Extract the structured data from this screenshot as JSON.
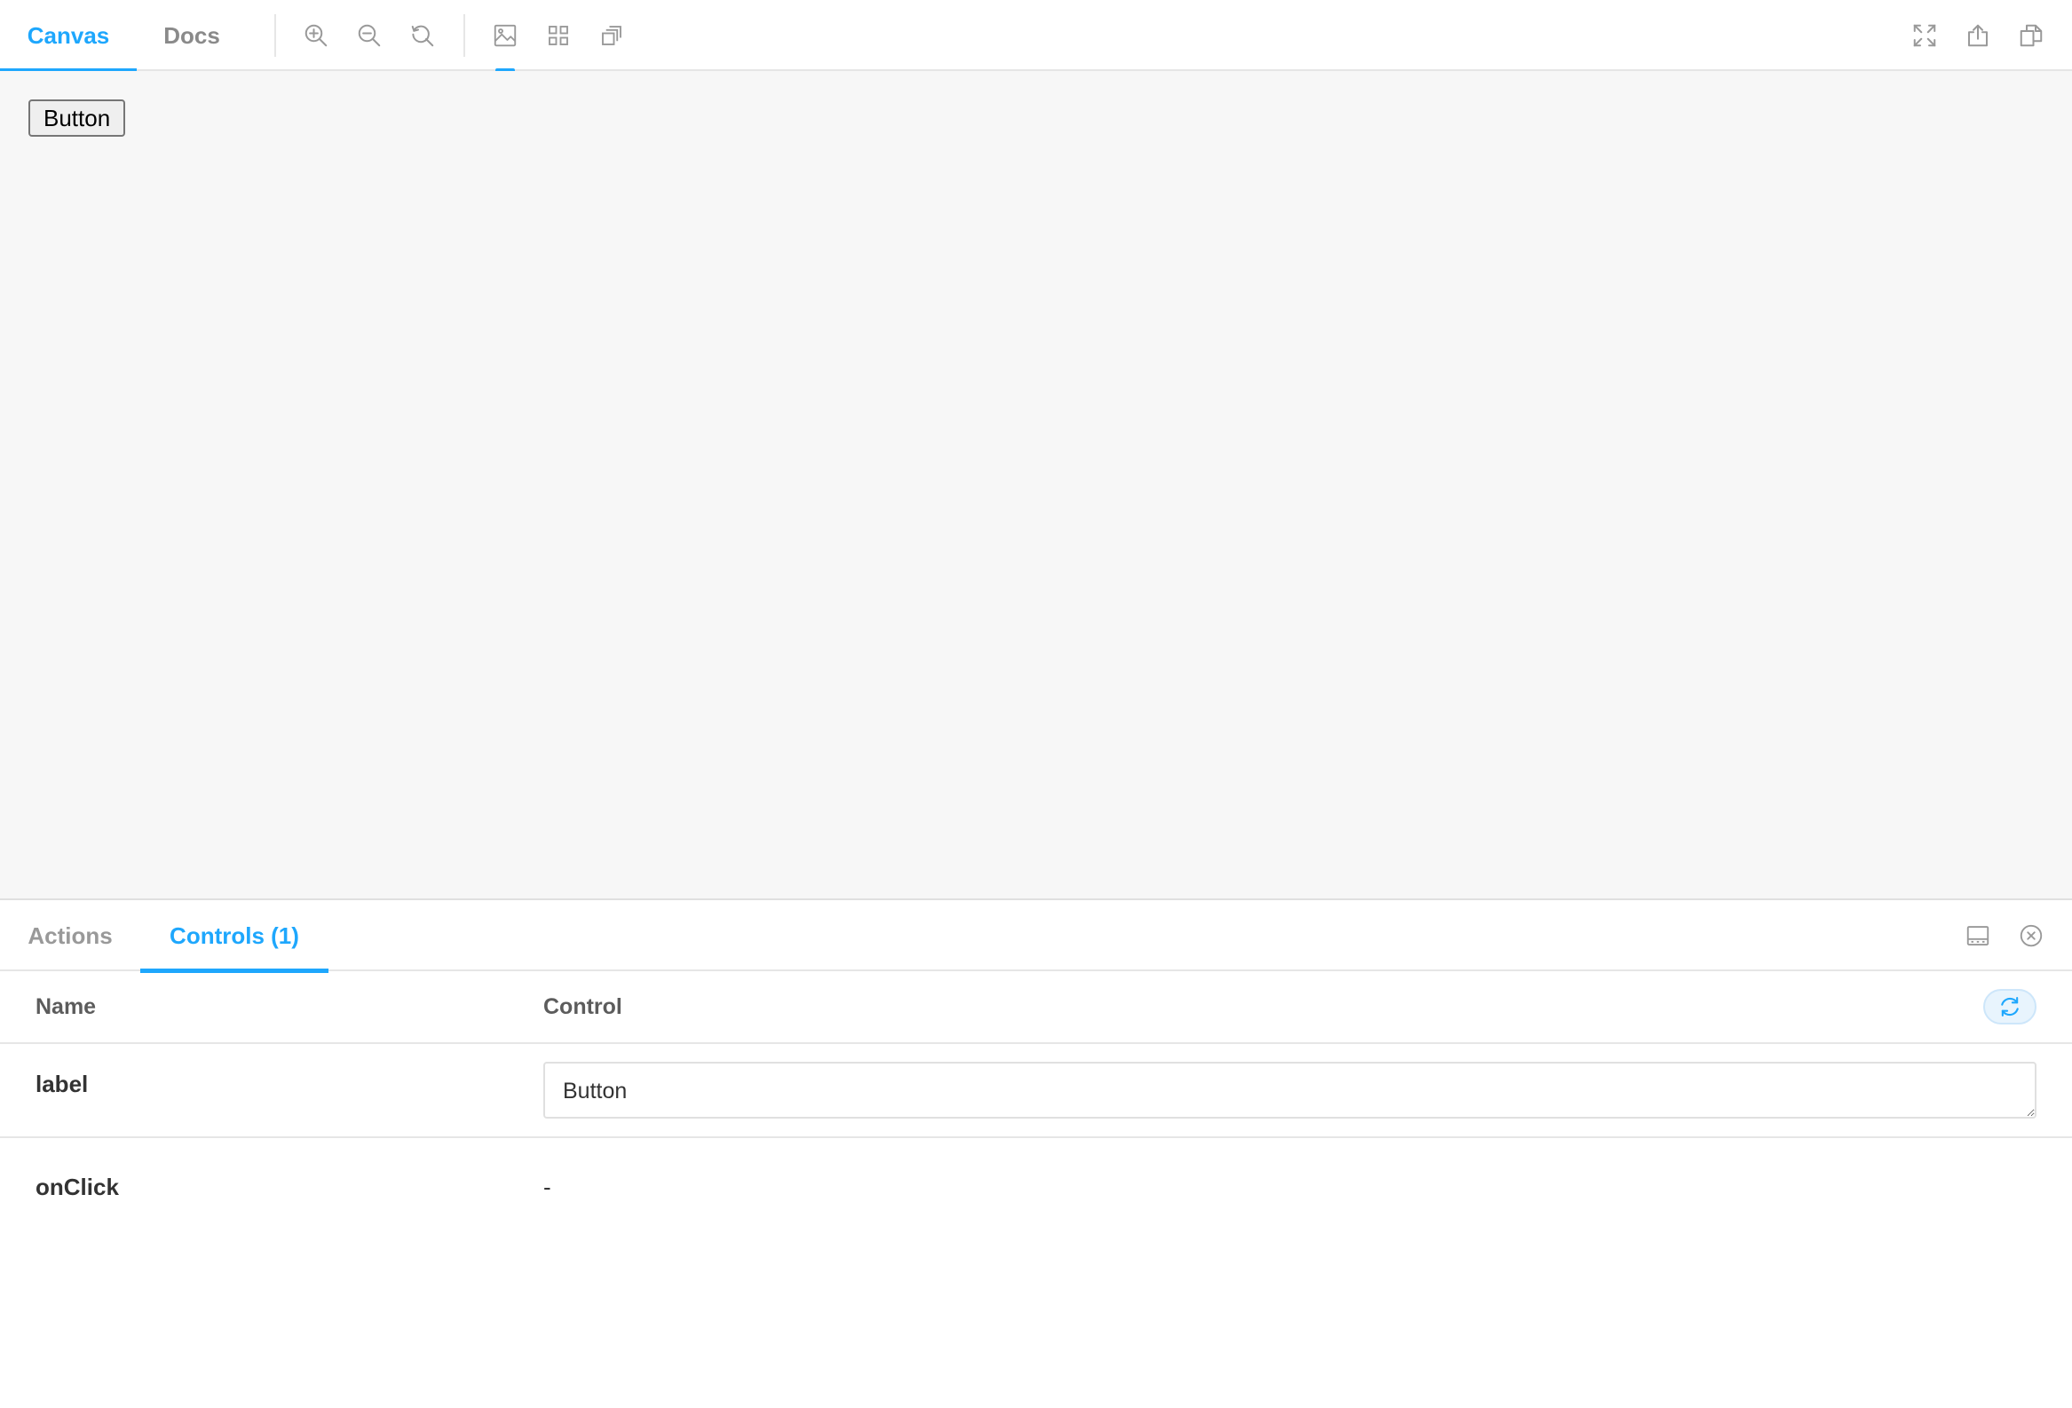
{
  "toolbar": {
    "tabs": [
      {
        "label": "Canvas",
        "active": true
      },
      {
        "label": "Docs",
        "active": false
      }
    ],
    "zoom_tools": [
      "zoom-in-icon",
      "zoom-out-icon",
      "zoom-reset-icon"
    ],
    "view_tools": [
      "background-icon",
      "grid-icon",
      "viewport-icon"
    ],
    "right_tools": [
      "fullscreen-icon",
      "share-icon",
      "copy-icon"
    ]
  },
  "canvas": {
    "button_label": "Button"
  },
  "panel": {
    "tabs": [
      {
        "label": "Actions",
        "active": false
      },
      {
        "label": "Controls (1)",
        "active": true
      }
    ],
    "icons": [
      "panel-orientation-icon",
      "close-icon"
    ],
    "table": {
      "headers": {
        "name": "Name",
        "control": "Control"
      },
      "rows": [
        {
          "name": "label",
          "value": "Button"
        },
        {
          "name": "onClick",
          "value": "-"
        }
      ]
    }
  },
  "colors": {
    "accent": "#1ea7fd",
    "canvas_bg": "#f7f7f7",
    "border": "#e6e6e6",
    "muted_text": "#999999"
  }
}
